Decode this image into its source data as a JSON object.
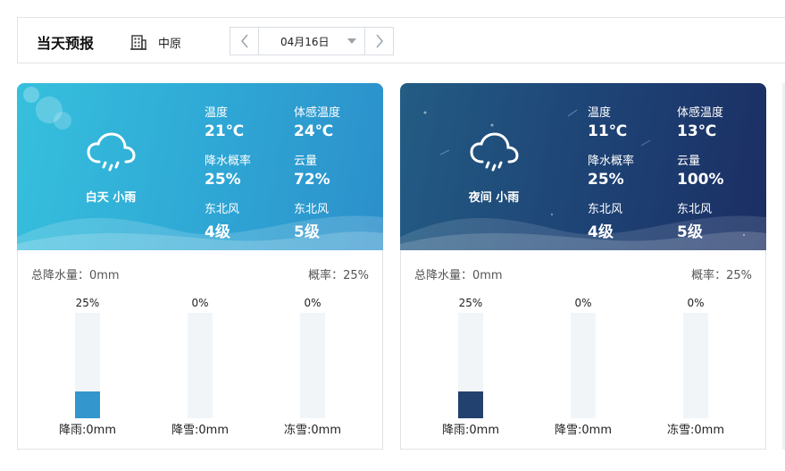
{
  "header": {
    "title": "当天预报",
    "location": "中原",
    "date": "04月16日"
  },
  "icons": {
    "building": "building-icon",
    "prev": "chevron-left-icon",
    "next": "chevron-right-icon",
    "caret": "caret-down-icon",
    "weather": "cloud-rain-icon"
  },
  "colors": {
    "day_bar": "#3396cd",
    "night_bar": "#23416e"
  },
  "day": {
    "period": "白天 小雨",
    "temp_label": "温度",
    "temp": "21℃",
    "feels_label": "体感温度",
    "feels": "24℃",
    "rain_prob_label": "降水概率",
    "rain_prob": "25%",
    "cloud_label": "云量",
    "cloud": "72%",
    "wind_dir_label": "东北风",
    "wind_dir": "4级",
    "wind2_label": "东北风",
    "wind2": "5级",
    "total_precip": "总降水量：0mm",
    "probability": "概率：25%",
    "bars": [
      {
        "pct": "25%",
        "value": 0.25,
        "label": "降雨:0mm"
      },
      {
        "pct": "0%",
        "value": 0,
        "label": "降雪:0mm"
      },
      {
        "pct": "0%",
        "value": 0,
        "label": "冻雪:0mm"
      }
    ]
  },
  "night": {
    "period": "夜间 小雨",
    "temp_label": "温度",
    "temp": "11℃",
    "feels_label": "体感温度",
    "feels": "13℃",
    "rain_prob_label": "降水概率",
    "rain_prob": "25%",
    "cloud_label": "云量",
    "cloud": "100%",
    "wind_dir_label": "东北风",
    "wind_dir": "4级",
    "wind2_label": "东北风",
    "wind2": "5级",
    "total_precip": "总降水量：0mm",
    "probability": "概率：25%",
    "bars": [
      {
        "pct": "25%",
        "value": 0.25,
        "label": "降雨:0mm"
      },
      {
        "pct": "0%",
        "value": 0,
        "label": "降雪:0mm"
      },
      {
        "pct": "0%",
        "value": 0,
        "label": "冻雪:0mm"
      }
    ]
  }
}
